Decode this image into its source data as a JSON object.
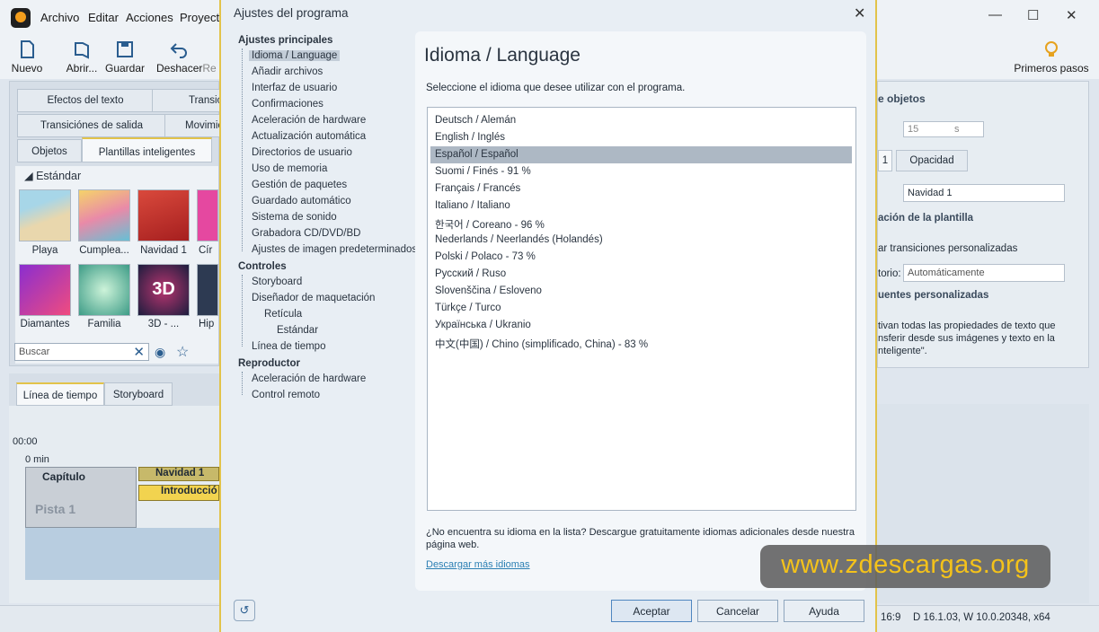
{
  "app": {
    "menu": [
      "Archivo",
      "Editar",
      "Acciones",
      "Proyecto"
    ],
    "toolbar": {
      "new": "Nuevo",
      "open": "Abrir...",
      "save": "Guardar",
      "undo": "Deshacer",
      "redo": "Re"
    },
    "primeros_pasos": "Primeros pasos",
    "left_tabs": {
      "effects": "Efectos del texto",
      "transitions": "Transic",
      "exit": "Transiciónes de salida",
      "motion": "Movimie",
      "objects": "Objetos",
      "templates": "Plantillas inteligentes"
    },
    "category": "Estándar",
    "thumbs": [
      "Playa",
      "Cumplea...",
      "Navidad 1",
      "Cír",
      "Diamantes",
      "Familia",
      "3D - ...",
      "Hip"
    ],
    "search_placeholder": "Buscar",
    "timeline_tabs": {
      "timeline": "Línea de tiempo",
      "storyboard": "Storyboard"
    },
    "time_zero": "00:00",
    "min_label": "0 min",
    "track_chapter": "Capítulo",
    "track_navidad": "Navidad 1",
    "track_intro": "Introducció",
    "track_pista": "Pista 1",
    "right_panel": {
      "title": "e objetos",
      "duration": "15",
      "unit": "s",
      "tab1": "1",
      "tab_opacity": "Opacidad",
      "name_value": "Navidad 1",
      "section1": "ación de la plantilla",
      "custom_trans": "ar transiciones personalizadas",
      "auto_label": "torio:",
      "auto_value": "Automáticamente",
      "section2": "uentes personalizadas",
      "desc1": "tivan todas las propiedades de texto que",
      "desc2": "nsferir desde sus imágenes y texto en la",
      "desc3": "nteligente\"."
    },
    "status": {
      "ratio": "16:9",
      "version": "D 16.1.03, W 10.0.20348, x64"
    }
  },
  "dialog": {
    "title": "Ajustes del programa",
    "tree": {
      "group1": "Ajustes principales",
      "items1": [
        "Idioma / Language",
        "Añadir archivos",
        "Interfaz de usuario",
        "Confirmaciones",
        "Aceleración de hardware",
        "Actualización automática",
        "Directorios de usuario",
        "Uso de memoria",
        "Gestión de paquetes",
        "Guardado automático",
        "Sistema de sonido",
        "Grabadora CD/DVD/BD",
        "Ajustes de imagen predeterminados"
      ],
      "group2": "Controles",
      "items2": [
        "Storyboard",
        "Diseñador de maquetación",
        "Retícula",
        "Estándar",
        "Línea de tiempo"
      ],
      "group3": "Reproductor",
      "items3": [
        "Aceleración de hardware",
        "Control remoto"
      ]
    },
    "heading": "Idioma / Language",
    "instruction": "Seleccione el idioma que desee utilizar con el programa.",
    "languages": [
      "Deutsch / Alemán",
      "English / Inglés",
      "Español / Español",
      "Suomi / Finés  -  91 %",
      "Français / Francés",
      "Italiano / Italiano",
      "한국어 / Coreano  -  96 %",
      "Nederlands / Neerlandés (Holandés)",
      "Polski / Polaco  -  73 %",
      "Русский / Ruso",
      "Slovenščina / Esloveno",
      "Türkçe / Turco",
      "Українська / Ukranio",
      "中文(中国) / Chino (simplificado, China)  -  83 %"
    ],
    "selected_index": 2,
    "missing_text_1": "¿No encuentra su idioma en la lista? Descargue gratuitamente idiomas adicionales desde nuestra",
    "missing_text_2": "página web.",
    "download_link": "Descargar más idiomas",
    "buttons": {
      "ok": "Aceptar",
      "cancel": "Cancelar",
      "help": "Ayuda"
    }
  },
  "watermark": "www.zdescargas.org"
}
